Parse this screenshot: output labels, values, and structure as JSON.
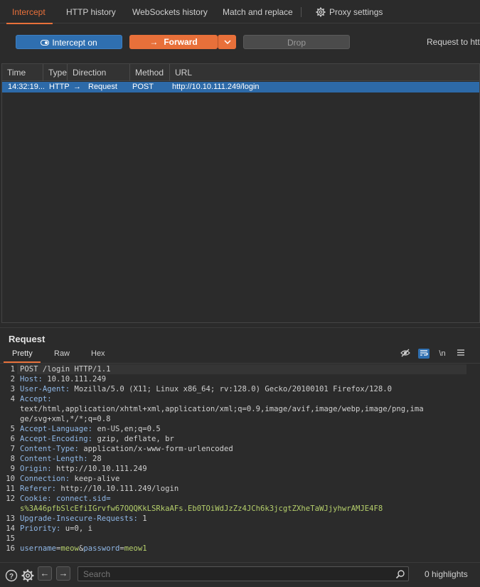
{
  "tabs": [
    {
      "label": "Intercept"
    },
    {
      "label": "HTTP history"
    },
    {
      "label": "WebSockets history"
    },
    {
      "label": "Match and replace"
    },
    {
      "label": "Proxy settings"
    }
  ],
  "toolbar": {
    "intercept_label": "Intercept on",
    "forward_label": "Forward",
    "drop_label": "Drop",
    "request_to": "Request to http"
  },
  "table": {
    "columns": [
      "Time",
      "Type",
      "Direction",
      "Method",
      "URL"
    ],
    "rows": [
      {
        "time": "14:32:19...",
        "type": "HTTP",
        "direction": "Request",
        "method": "POST",
        "url": "http://10.10.111.249/login"
      }
    ]
  },
  "request": {
    "title": "Request",
    "tabs": [
      "Pretty",
      "Raw",
      "Hex"
    ],
    "newline_toggle": "\\n",
    "lines": {
      "l1": "POST /login HTTP/1.1",
      "l2k": "Host:",
      "l2v": " 10.10.111.249",
      "l3k": "User-Agent:",
      "l3v": " Mozilla/5.0 (X11; Linux x86_64; rv:128.0) Gecko/20100101 Firefox/128.0",
      "l4k": "Accept:",
      "l4v1": "text/html,application/xhtml+xml,application/xml;q=0.9,image/avif,image/webp,image/png,ima",
      "l4v2": "ge/svg+xml,*/*;q=0.8",
      "l5k": "Accept-Language:",
      "l5v": " en-US,en;q=0.5",
      "l6k": "Accept-Encoding:",
      "l6v": " gzip, deflate, br",
      "l7k": "Content-Type:",
      "l7v": " application/x-www-form-urlencoded",
      "l8k": "Content-Length:",
      "l8v": " 28",
      "l9k": "Origin:",
      "l9v": " http://10.10.111.249",
      "l10k": "Connection:",
      "l10v": " keep-alive",
      "l11k": "Referer:",
      "l11v": " http://10.10.111.249/login",
      "l12k": "Cookie:",
      "l12n": " connect.sid=",
      "l12v": "s%3A46pfbSlcEfiIGrvfw67OQQKkLSRkaAFs.Eb0TOiWdJzZz4JCh6k3jcgtZXheTaWJjyhwrAMJE4F8",
      "l13k": "Upgrade-Insecure-Requests:",
      "l13v": " 1",
      "l14k": "Priority:",
      "l14v": " u=0, i",
      "l16a": "username",
      "l16b": "=",
      "l16c": "meow",
      "l16d": "&",
      "l16e": "password",
      "l16f": "=",
      "l16g": "meow1"
    },
    "line_numbers": [
      "1",
      "2",
      "3",
      "4",
      "5",
      "6",
      "7",
      "8",
      "9",
      "10",
      "11",
      "12",
      "13",
      "14",
      "15",
      "16"
    ]
  },
  "bottom": {
    "search_placeholder": "Search",
    "highlights": "0 highlights"
  },
  "colors": {
    "accent": "#e8703a",
    "selection": "#2d6aa8",
    "header_name": "#8fb7e6",
    "cookie_value": "#b5cf6b"
  }
}
